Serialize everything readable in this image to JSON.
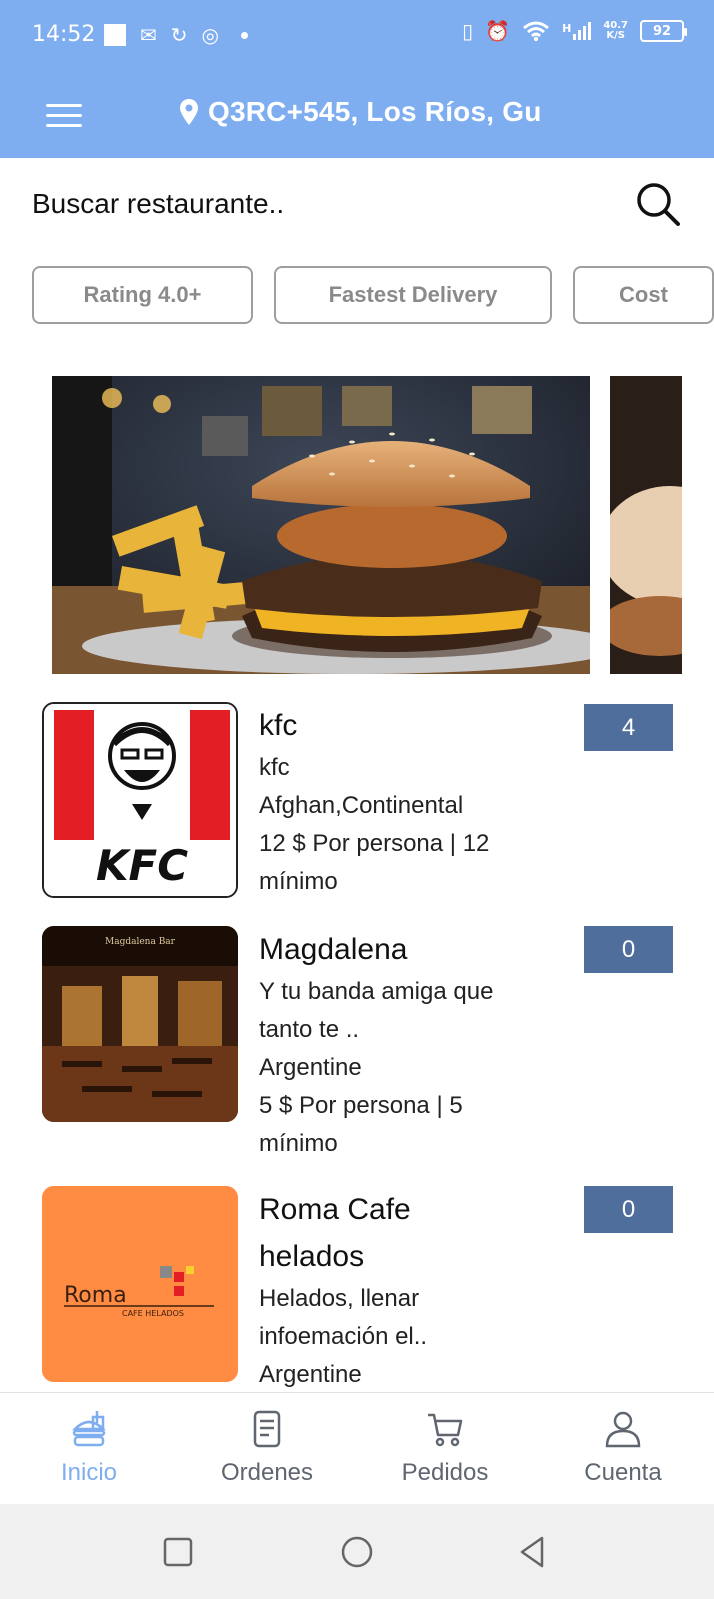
{
  "status_bar": {
    "time": "14:52",
    "net_speed_top": "40.7",
    "net_speed_bottom": "K/S",
    "signal_label": "H",
    "battery": "92"
  },
  "app_bar": {
    "location": "Q3RC+545, Los Ríos, Gu",
    "accent_color": "#7faef0"
  },
  "search": {
    "placeholder": "Buscar restaurante.."
  },
  "filters": [
    {
      "label": "Rating 4.0+"
    },
    {
      "label": "Fastest Delivery"
    },
    {
      "label": "Cost"
    }
  ],
  "restaurants": [
    {
      "name": "kfc",
      "lines": [
        "kfc",
        "Afghan,Continental",
        "12 $ Por persona | 12",
        "mínimo"
      ],
      "rating": "4",
      "logo": "kfc-logo"
    },
    {
      "name": "Magdalena",
      "lines": [
        "Y tu banda amiga que",
        "tanto te ..",
        "Argentine",
        "5 $ Por persona | 5",
        "mínimo"
      ],
      "rating": "0",
      "logo": "magdalena-photo",
      "logo_text": "Magdalena Bar"
    },
    {
      "name_lines": [
        "Roma Cafe",
        "helados"
      ],
      "lines": [
        "Helados, llenar",
        "infoemación el..",
        "Argentine"
      ],
      "rating": "0",
      "logo": "roma-logo",
      "logo_text": "Roma",
      "logo_sub": "CAFE HELADOS"
    }
  ],
  "bottom_nav": [
    {
      "label": "Inicio",
      "icon": "food-icon",
      "active": true
    },
    {
      "label": "Ordenes",
      "icon": "receipt-icon",
      "active": false
    },
    {
      "label": "Pedidos",
      "icon": "cart-icon",
      "active": false
    },
    {
      "label": "Cuenta",
      "icon": "person-icon",
      "active": false
    }
  ]
}
